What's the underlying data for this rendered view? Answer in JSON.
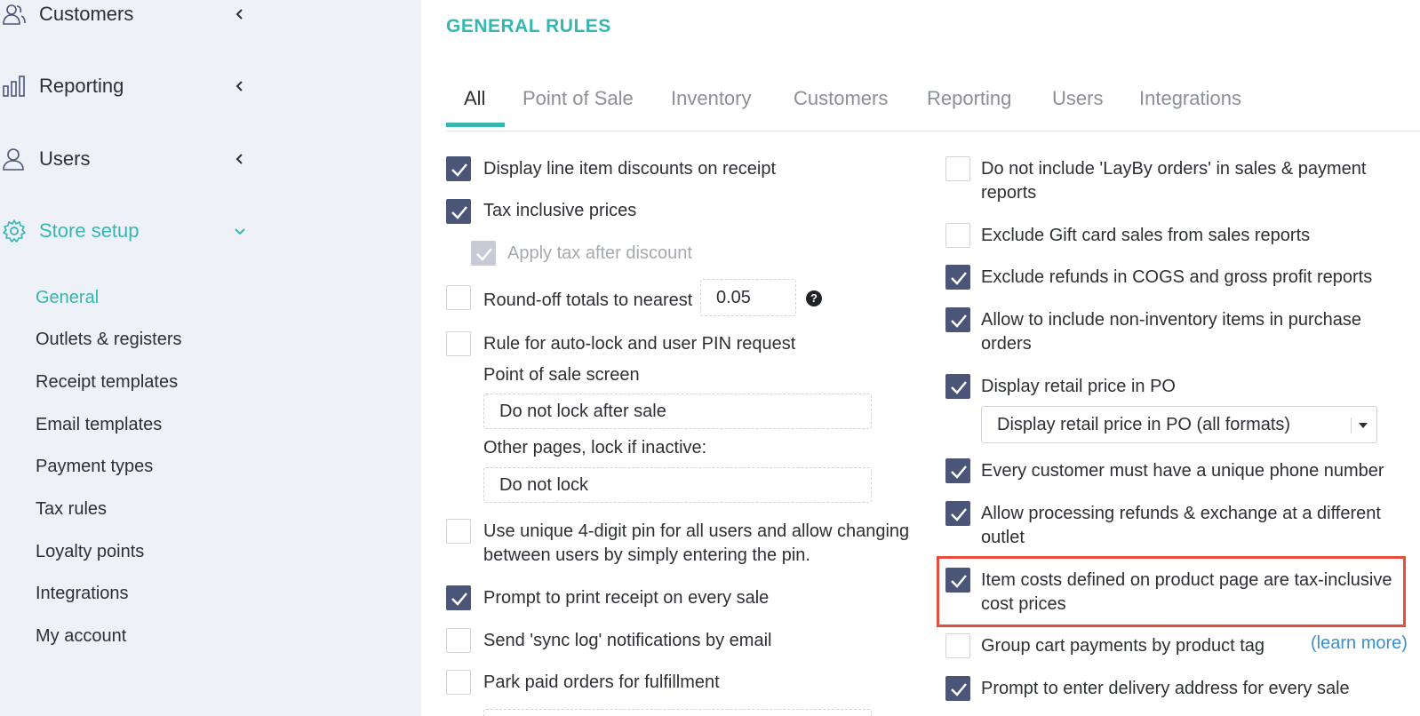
{
  "sidebar": {
    "nav": [
      {
        "label": "Customers",
        "icon": "customers-icon"
      },
      {
        "label": "Reporting",
        "icon": "reporting-icon"
      },
      {
        "label": "Users",
        "icon": "users-icon"
      },
      {
        "label": "Store setup",
        "icon": "gear-icon"
      }
    ],
    "sub_items": [
      {
        "label": "General"
      },
      {
        "label": "Outlets & registers"
      },
      {
        "label": "Receipt templates"
      },
      {
        "label": "Email templates"
      },
      {
        "label": "Payment types"
      },
      {
        "label": "Tax rules"
      },
      {
        "label": "Loyalty points"
      },
      {
        "label": "Integrations"
      },
      {
        "label": "My account"
      }
    ]
  },
  "main": {
    "title": "GENERAL RULES",
    "tabs": [
      "All",
      "Point of Sale",
      "Inventory",
      "Customers",
      "Reporting",
      "Users",
      "Integrations"
    ],
    "active_tab": "All",
    "left": {
      "display_line_discounts": {
        "label": "Display line item discounts on receipt",
        "checked": true
      },
      "tax_inclusive": {
        "label": "Tax inclusive prices",
        "checked": true
      },
      "apply_tax_after_discount": {
        "label": "Apply tax after discount",
        "checked": true,
        "disabled": true
      },
      "round_off": {
        "label": "Round-off totals to nearest",
        "value": "0.05",
        "checked": false
      },
      "auto_lock": {
        "label": "Rule for auto-lock and user PIN request",
        "checked": false
      },
      "pos_screen_label": "Point of sale screen",
      "pos_screen_value": "Do not lock after sale",
      "other_pages_label": "Other pages, lock if inactive:",
      "other_pages_value": "Do not lock",
      "unique_pin": {
        "label_line1": "Use unique 4-digit pin for all users and allow changing",
        "label_line2": "between users by simply entering the pin.",
        "checked": false
      },
      "prompt_print": {
        "label": "Prompt to print receipt on every sale",
        "checked": true
      },
      "sync_log": {
        "label": "Send 'sync log' notifications by email",
        "checked": false
      },
      "park_paid": {
        "label": "Park paid orders for fulfillment",
        "checked": false
      }
    },
    "right": {
      "no_layby": {
        "label_line1": "Do not include 'LayBy orders' in sales & payment",
        "label_line2": "reports",
        "checked": false
      },
      "exclude_gift": {
        "label": "Exclude Gift card sales from sales reports",
        "checked": false
      },
      "exclude_refunds": {
        "label": "Exclude refunds in COGS and gross profit reports",
        "checked": true
      },
      "non_inventory": {
        "label_line1": "Allow to include non-inventory items in purchase",
        "label_line2": "orders",
        "checked": true
      },
      "retail_price_po": {
        "label": "Display retail price in PO",
        "checked": true,
        "select_value": "Display retail price in PO (all formats)"
      },
      "unique_phone": {
        "label": "Every customer must have a unique phone number",
        "checked": true
      },
      "refunds_outlet": {
        "label_line1": "Allow processing refunds & exchange at a different",
        "label_line2": "outlet",
        "checked": true
      },
      "item_costs": {
        "label_line1": "Item costs defined on product page are tax-inclusive",
        "label_line2": "cost prices",
        "checked": true
      },
      "group_cart": {
        "label": "Group cart payments by product tag",
        "checked": false,
        "learn_more": "(learn more)"
      },
      "delivery_address": {
        "label": "Prompt to enter delivery address for every sale",
        "checked": true
      }
    },
    "colors": {
      "accent": "#35b6b4",
      "checkbox_checked": "#4a5577",
      "highlight": "#e74c3c",
      "link": "#3a8fd0"
    }
  }
}
